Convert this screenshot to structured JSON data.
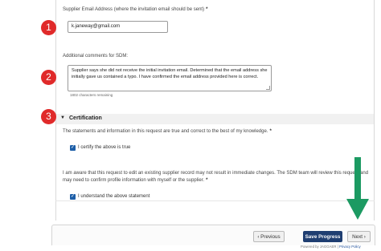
{
  "email_section": {
    "label": "Supplier Email Address (where the invitation email should be sent)",
    "required_mark": "*",
    "value": "k.janeway@gmail.com"
  },
  "comments_section": {
    "label": "Additional comments for SDM:",
    "text": "Supplier says she did not receive the initial invitation email. Determined that the email address she initially gave us contained a typo. I have confirmed the email address provided here is correct.",
    "counter": "1802 characters remaining"
  },
  "badges": [
    "1",
    "2",
    "3"
  ],
  "certification": {
    "title": "Certification",
    "chevron_icon": "chevron-down-icon",
    "statement1": "The statements and information in this request are true and correct to the best of my knowledge.",
    "statement1_req": "*",
    "checkbox1_label": "I certify the above is true",
    "statement2_line1": "I am aware that this request to edit an existing supplier record may not result in immediate changes. The SDM team will review this request and",
    "statement2_line2": "may need to confirm profile information with myself or the supplier.",
    "statement2_req": "*",
    "checkbox2_label": "I understand the above statement"
  },
  "footer": {
    "previous_label": "‹ Previous",
    "save_label": "Save Progress",
    "next_label": "Next ›",
    "powered_by": "Powered by JAGGAER |",
    "privacy_link": "Privacy Policy"
  },
  "colors": {
    "badge": "#e02a2a",
    "save_button": "#1f3e71",
    "checkbox": "#1e5fa8",
    "arrow": "#1c9a62"
  }
}
